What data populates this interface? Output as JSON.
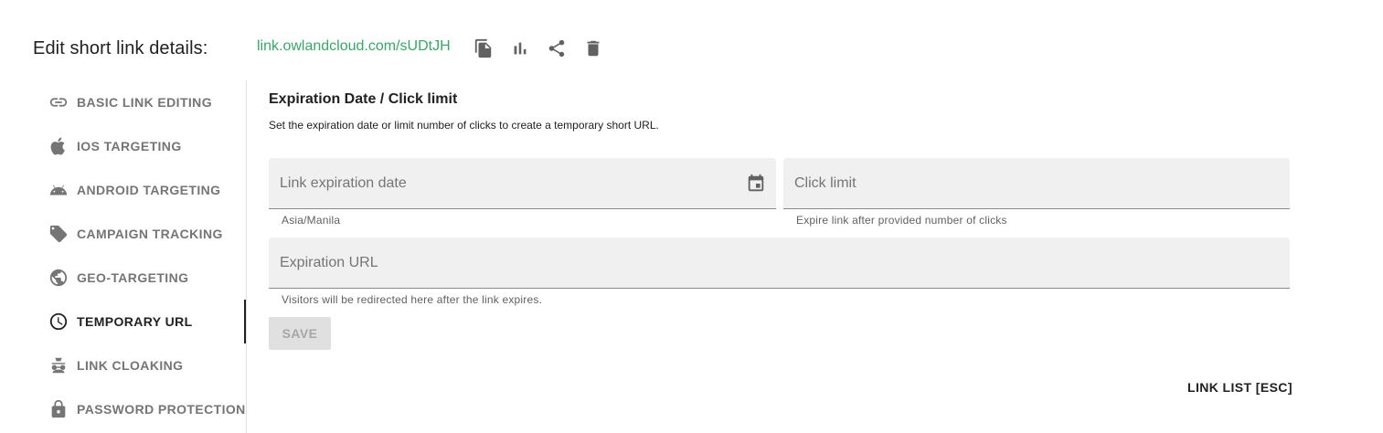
{
  "header": {
    "title": "Edit short link details:",
    "short_url": "link.owlandcloud.com/sUDtJH",
    "icons": [
      "copy-icon",
      "stats-icon",
      "share-icon",
      "delete-icon"
    ]
  },
  "sidebar": {
    "items": [
      {
        "label": "BASIC LINK EDITING",
        "icon": "link-icon",
        "active": false
      },
      {
        "label": "IOS TARGETING",
        "icon": "apple-icon",
        "active": false
      },
      {
        "label": "ANDROID TARGETING",
        "icon": "android-icon",
        "active": false
      },
      {
        "label": "CAMPAIGN TRACKING",
        "icon": "tag-icon",
        "active": false
      },
      {
        "label": "GEO-TARGETING",
        "icon": "globe-icon",
        "active": false
      },
      {
        "label": "TEMPORARY URL",
        "icon": "clock-icon",
        "active": true
      },
      {
        "label": "LINK CLOAKING",
        "icon": "spy-icon",
        "active": false
      },
      {
        "label": "PASSWORD PROTECTION",
        "icon": "lock-icon",
        "active": false
      }
    ]
  },
  "main": {
    "title": "Expiration Date / Click limit",
    "description": "Set the expiration date or limit number of clicks to create a temporary short URL.",
    "expiration_date": {
      "placeholder": "Link expiration date",
      "value": "",
      "hint": "Asia/Manila"
    },
    "click_limit": {
      "placeholder": "Click limit",
      "value": "",
      "hint": "Expire link after provided number of clicks"
    },
    "expiration_url": {
      "placeholder": "Expiration URL",
      "value": "",
      "hint": "Visitors will be redirected here after the link expires."
    },
    "save_label": "SAVE"
  },
  "footer": {
    "link_list_label": "LINK LIST [ESC]"
  },
  "colors": {
    "accent_link": "#3aa46b",
    "text_primary": "#212121",
    "text_secondary": "#757575",
    "field_bg": "#f0f0f0",
    "disabled_button_bg": "#e0e0e0"
  }
}
